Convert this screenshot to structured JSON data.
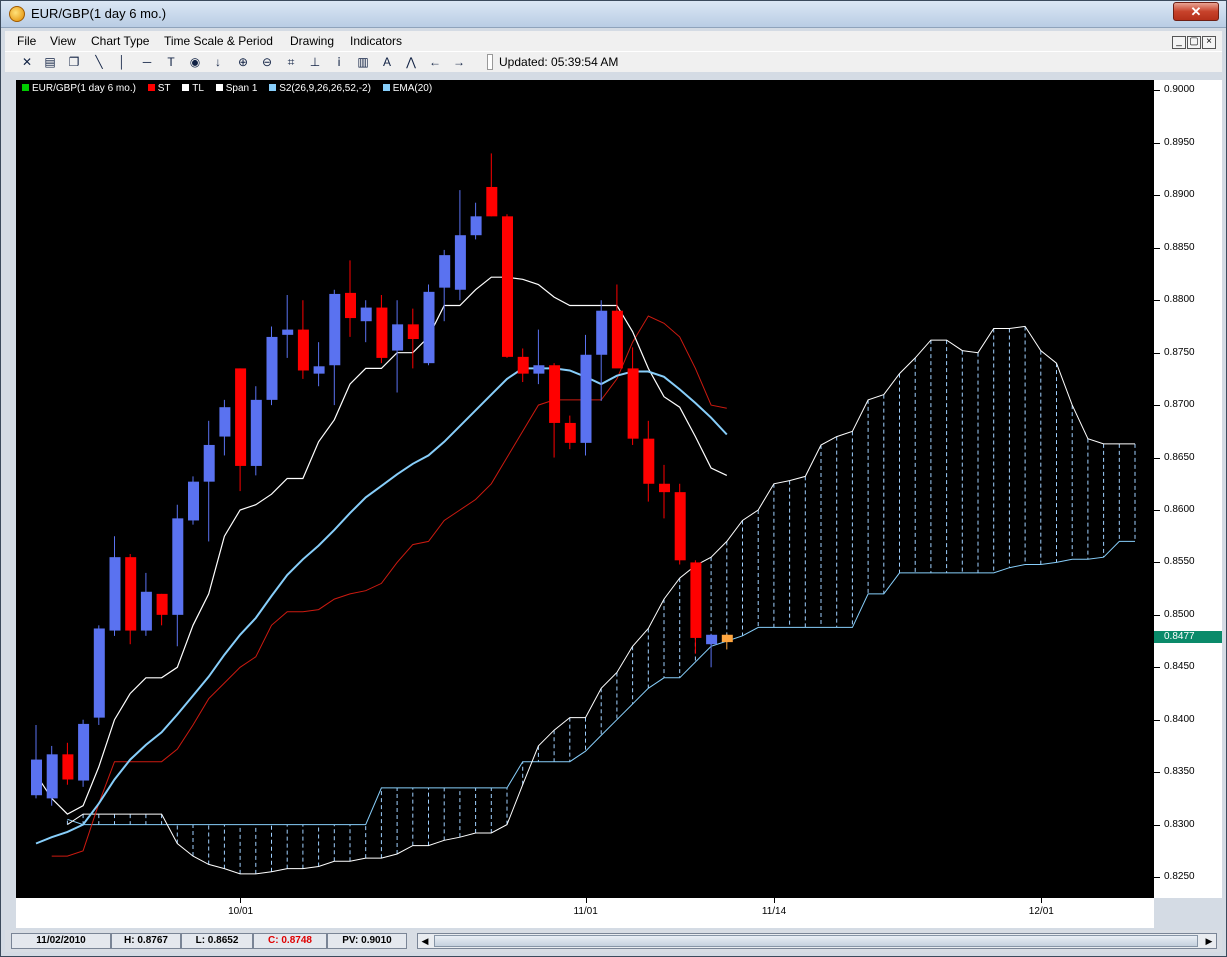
{
  "window": {
    "title": "EUR/GBP(1 day  6 mo.)",
    "close_label": "✕"
  },
  "menu": [
    "File",
    "View",
    "Chart Type",
    "Time Scale & Period",
    "Drawing",
    "Indicators"
  ],
  "toolbar": {
    "icons": [
      "crosshair-icon",
      "print-icon",
      "copy-icon",
      "trendline-icon",
      "vertical-line-icon",
      "horizontal-line-icon",
      "text-icon",
      "target-icon",
      "down-arrow-icon",
      "zoom-in-icon",
      "zoom-out-icon",
      "fit-icon",
      "anchor-icon",
      "info-icon",
      "bar-icon",
      "text-a-icon",
      "zigzag-icon",
      "left-arrow-icon",
      "right-arrow-icon"
    ],
    "updated": "Updated: 05:39:54 AM"
  },
  "status": {
    "date": "11/02/2010",
    "high": "H: 0.8767",
    "low": "L: 0.8652",
    "close": "C: 0.8748",
    "pv": "PV: 0.9010"
  },
  "colors": {
    "up": "#5a72f0",
    "down": "#ff0000",
    "last": "#ffa640",
    "ema": "#87cefa",
    "kijun": "#ffffff",
    "tenkan": "#cc1a10",
    "cloud": "#9fd0ff"
  },
  "chart_data": {
    "type": "candlestick",
    "title": "",
    "legend": [
      {
        "name": "EUR/GBP(1 day  6 mo.)",
        "color": "#00cc00"
      },
      {
        "name": "ST",
        "color": "#ff0000"
      },
      {
        "name": "TL",
        "color": "#ffffff"
      },
      {
        "name": "Span 1",
        "color": "#ffffff"
      },
      {
        "name": "S2(26,9,26,26,52,-2)",
        "color": "#87cefa"
      },
      {
        "name": "EMA(20)",
        "color": "#87cefa"
      }
    ],
    "legend_position": "top-left",
    "y_ticks": [
      "0.9000",
      "0.8950",
      "0.8900",
      "0.8850",
      "0.8800",
      "0.8750",
      "0.8700",
      "0.8650",
      "0.8600",
      "0.8550",
      "0.8500",
      "0.8450",
      "0.8400",
      "0.8350",
      "0.8300",
      "0.8250"
    ],
    "ylim": [
      0.823,
      0.901
    ],
    "x_ticks": [
      {
        "label": "10/01",
        "i": 13
      },
      {
        "label": "11/01",
        "i": 35
      },
      {
        "label": "11/14",
        "i": 47
      },
      {
        "label": "12/01",
        "i": 64
      }
    ],
    "current_value": "0.8477",
    "candles": [
      {
        "o": 0.8328,
        "h": 0.8395,
        "l": 0.8325,
        "c": 0.8362
      },
      {
        "o": 0.8325,
        "h": 0.8375,
        "l": 0.8318,
        "c": 0.8367
      },
      {
        "o": 0.8367,
        "h": 0.8378,
        "l": 0.8338,
        "c": 0.8343
      },
      {
        "o": 0.8342,
        "h": 0.84,
        "l": 0.8336,
        "c": 0.8396
      },
      {
        "o": 0.8402,
        "h": 0.849,
        "l": 0.8395,
        "c": 0.8487
      },
      {
        "o": 0.8485,
        "h": 0.8575,
        "l": 0.848,
        "c": 0.8555
      },
      {
        "o": 0.8555,
        "h": 0.8558,
        "l": 0.8472,
        "c": 0.8485
      },
      {
        "o": 0.8485,
        "h": 0.854,
        "l": 0.848,
        "c": 0.8522
      },
      {
        "o": 0.852,
        "h": 0.852,
        "l": 0.849,
        "c": 0.85
      },
      {
        "o": 0.85,
        "h": 0.8605,
        "l": 0.847,
        "c": 0.8592
      },
      {
        "o": 0.859,
        "h": 0.8632,
        "l": 0.8586,
        "c": 0.8627
      },
      {
        "o": 0.8627,
        "h": 0.8685,
        "l": 0.857,
        "c": 0.8662
      },
      {
        "o": 0.867,
        "h": 0.8705,
        "l": 0.8652,
        "c": 0.8698
      },
      {
        "o": 0.8735,
        "h": 0.8735,
        "l": 0.8618,
        "c": 0.8642
      },
      {
        "o": 0.8642,
        "h": 0.8718,
        "l": 0.8633,
        "c": 0.8705
      },
      {
        "o": 0.8705,
        "h": 0.8775,
        "l": 0.87,
        "c": 0.8765
      },
      {
        "o": 0.8767,
        "h": 0.8805,
        "l": 0.8745,
        "c": 0.8772
      },
      {
        "o": 0.8772,
        "h": 0.88,
        "l": 0.8725,
        "c": 0.8733
      },
      {
        "o": 0.873,
        "h": 0.876,
        "l": 0.8718,
        "c": 0.8737
      },
      {
        "o": 0.8738,
        "h": 0.881,
        "l": 0.87,
        "c": 0.8806
      },
      {
        "o": 0.8807,
        "h": 0.8838,
        "l": 0.8765,
        "c": 0.8783
      },
      {
        "o": 0.878,
        "h": 0.88,
        "l": 0.876,
        "c": 0.8793
      },
      {
        "o": 0.8793,
        "h": 0.8805,
        "l": 0.874,
        "c": 0.8745
      },
      {
        "o": 0.8752,
        "h": 0.88,
        "l": 0.8712,
        "c": 0.8777
      },
      {
        "o": 0.8777,
        "h": 0.8792,
        "l": 0.8735,
        "c": 0.8763
      },
      {
        "o": 0.874,
        "h": 0.8815,
        "l": 0.8738,
        "c": 0.8808
      },
      {
        "o": 0.8812,
        "h": 0.8848,
        "l": 0.878,
        "c": 0.8843
      },
      {
        "o": 0.881,
        "h": 0.8905,
        "l": 0.88,
        "c": 0.8862
      },
      {
        "o": 0.8862,
        "h": 0.8893,
        "l": 0.8858,
        "c": 0.888
      },
      {
        "o": 0.8908,
        "h": 0.894,
        "l": 0.888,
        "c": 0.888
      },
      {
        "o": 0.888,
        "h": 0.8882,
        "l": 0.8745,
        "c": 0.8746
      },
      {
        "o": 0.8746,
        "h": 0.8754,
        "l": 0.8722,
        "c": 0.873
      },
      {
        "o": 0.873,
        "h": 0.8772,
        "l": 0.872,
        "c": 0.8738
      },
      {
        "o": 0.8738,
        "h": 0.874,
        "l": 0.865,
        "c": 0.8683
      },
      {
        "o": 0.8683,
        "h": 0.869,
        "l": 0.8658,
        "c": 0.8664
      },
      {
        "o": 0.8664,
        "h": 0.8767,
        "l": 0.8652,
        "c": 0.8748
      },
      {
        "o": 0.8748,
        "h": 0.88,
        "l": 0.8704,
        "c": 0.879
      },
      {
        "o": 0.879,
        "h": 0.8815,
        "l": 0.874,
        "c": 0.8735
      },
      {
        "o": 0.8735,
        "h": 0.8755,
        "l": 0.8662,
        "c": 0.8668
      },
      {
        "o": 0.8668,
        "h": 0.8685,
        "l": 0.8608,
        "c": 0.8625
      },
      {
        "o": 0.8625,
        "h": 0.8643,
        "l": 0.8592,
        "c": 0.8617
      },
      {
        "o": 0.8617,
        "h": 0.8625,
        "l": 0.8548,
        "c": 0.8552
      },
      {
        "o": 0.855,
        "h": 0.8552,
        "l": 0.8463,
        "c": 0.8478
      },
      {
        "o": 0.8472,
        "h": 0.8482,
        "l": 0.845,
        "c": 0.8481
      },
      {
        "o": 0.8474,
        "h": 0.8482,
        "l": 0.8467,
        "c": 0.8481
      }
    ],
    "series": [
      {
        "name": "EMA(20)",
        "color": "#87cefa",
        "x": [
          0,
          1,
          2,
          3,
          4,
          5,
          6,
          7,
          8,
          9,
          10,
          11,
          12,
          13,
          14,
          15,
          16,
          17,
          18,
          19,
          20,
          21,
          22,
          23,
          24,
          25,
          26,
          27,
          28,
          29,
          30,
          31,
          32,
          33,
          34,
          35,
          36,
          37,
          38,
          39,
          40,
          41,
          42,
          43,
          44
        ],
        "values": [
          0.8282,
          0.8288,
          0.8293,
          0.83,
          0.832,
          0.8343,
          0.8362,
          0.8376,
          0.8388,
          0.8405,
          0.8423,
          0.8441,
          0.8462,
          0.8481,
          0.8497,
          0.8518,
          0.8538,
          0.8553,
          0.8566,
          0.8581,
          0.8597,
          0.8612,
          0.8623,
          0.8634,
          0.8644,
          0.8652,
          0.8665,
          0.868,
          0.8695,
          0.871,
          0.8725,
          0.8735,
          0.8735,
          0.8735,
          0.8733,
          0.8727,
          0.872,
          0.8728,
          0.8732,
          0.8732,
          0.8727,
          0.8715,
          0.8702,
          0.8688,
          0.8672
        ]
      },
      {
        "name": "TL",
        "color": "#ffffff",
        "x": [
          0,
          1,
          2,
          3,
          4,
          5,
          6,
          7,
          8,
          9,
          10,
          11,
          12,
          13,
          14,
          15,
          16,
          17,
          18,
          19,
          20,
          21,
          22,
          23,
          24,
          25,
          26,
          27,
          28,
          29,
          30,
          31,
          32,
          33,
          34,
          35,
          36,
          37,
          38,
          39,
          40,
          41,
          42,
          43,
          44
        ],
        "values": [
          0.8348,
          0.8325,
          0.831,
          0.8318,
          0.8355,
          0.84,
          0.8425,
          0.844,
          0.844,
          0.845,
          0.849,
          0.852,
          0.8575,
          0.86,
          0.8605,
          0.8615,
          0.863,
          0.863,
          0.8665,
          0.8686,
          0.872,
          0.8735,
          0.8735,
          0.875,
          0.875,
          0.8765,
          0.8795,
          0.8795,
          0.881,
          0.8822,
          0.8822,
          0.882,
          0.8815,
          0.8803,
          0.8795,
          0.8795,
          0.8795,
          0.8795,
          0.877,
          0.8735,
          0.8708,
          0.8698,
          0.867,
          0.864,
          0.8633
        ]
      },
      {
        "name": "ST",
        "color": "#cc1a10",
        "x": [
          1,
          2,
          3,
          4,
          5,
          6,
          7,
          8,
          9,
          10,
          11,
          12,
          13,
          14,
          15,
          16,
          17,
          18,
          19,
          20,
          21,
          22,
          23,
          24,
          25,
          26,
          27,
          28,
          29,
          30,
          31,
          32,
          33,
          34,
          35,
          36,
          37,
          38,
          39,
          40,
          41,
          42,
          43,
          44
        ],
        "values": [
          0.827,
          0.827,
          0.8275,
          0.832,
          0.836,
          0.836,
          0.836,
          0.836,
          0.8372,
          0.8395,
          0.842,
          0.8435,
          0.845,
          0.846,
          0.849,
          0.8503,
          0.8503,
          0.8505,
          0.8515,
          0.852,
          0.8523,
          0.853,
          0.855,
          0.8567,
          0.857,
          0.859,
          0.86,
          0.861,
          0.8625,
          0.865,
          0.8675,
          0.87,
          0.8705,
          0.8705,
          0.8705,
          0.8705,
          0.8725,
          0.876,
          0.8785,
          0.8778,
          0.8765,
          0.8735,
          0.87,
          0.8697
        ]
      },
      {
        "name": "Span 1",
        "color": "#ffffff",
        "x": [
          2,
          3,
          4,
          5,
          6,
          7,
          8,
          9,
          10,
          11,
          12,
          13,
          14,
          15,
          16,
          17,
          18,
          19,
          20,
          21,
          22,
          23,
          24,
          25,
          26,
          27,
          28,
          29,
          30,
          31,
          32,
          33,
          34,
          35,
          36,
          37,
          38,
          39,
          40,
          41,
          42,
          43,
          44,
          45,
          46,
          47,
          48,
          49,
          50,
          51,
          52,
          53,
          54,
          55,
          56,
          57,
          58,
          59,
          60,
          61,
          62,
          63,
          64,
          65,
          66,
          67,
          68,
          69,
          70
        ],
        "values": [
          0.83,
          0.831,
          0.831,
          0.831,
          0.831,
          0.831,
          0.831,
          0.8282,
          0.827,
          0.8262,
          0.8258,
          0.8253,
          0.8253,
          0.8255,
          0.8258,
          0.8258,
          0.826,
          0.8265,
          0.8265,
          0.8268,
          0.8268,
          0.8272,
          0.828,
          0.828,
          0.8285,
          0.8288,
          0.8292,
          0.8292,
          0.83,
          0.8338,
          0.8375,
          0.839,
          0.8402,
          0.8402,
          0.843,
          0.8445,
          0.847,
          0.8487,
          0.8515,
          0.8535,
          0.8547,
          0.8555,
          0.857,
          0.859,
          0.86,
          0.8625,
          0.8628,
          0.8632,
          0.8662,
          0.867,
          0.8675,
          0.8705,
          0.871,
          0.873,
          0.8745,
          0.8762,
          0.8762,
          0.8752,
          0.875,
          0.8773,
          0.8773,
          0.8775,
          0.8752,
          0.874,
          0.87,
          0.8668,
          0.8663,
          0.8663,
          0.8663
        ]
      },
      {
        "name": "S2(26,9,26,26,52,-2)",
        "color": "#87cefa",
        "x": [
          2,
          3,
          4,
          5,
          6,
          7,
          8,
          9,
          10,
          11,
          12,
          13,
          14,
          15,
          16,
          17,
          18,
          19,
          20,
          21,
          22,
          23,
          24,
          25,
          26,
          27,
          28,
          29,
          30,
          31,
          32,
          33,
          34,
          35,
          36,
          37,
          38,
          39,
          40,
          41,
          42,
          43,
          44,
          45,
          46,
          47,
          48,
          49,
          50,
          51,
          52,
          53,
          54,
          55,
          56,
          57,
          58,
          59,
          60,
          61,
          62,
          63,
          64,
          65,
          66,
          67,
          68,
          69,
          70
        ],
        "values": [
          0.8305,
          0.83,
          0.83,
          0.83,
          0.83,
          0.83,
          0.83,
          0.83,
          0.83,
          0.83,
          0.83,
          0.83,
          0.83,
          0.83,
          0.83,
          0.83,
          0.83,
          0.83,
          0.83,
          0.83,
          0.8335,
          0.8335,
          0.8335,
          0.8335,
          0.8335,
          0.8335,
          0.8335,
          0.8335,
          0.8335,
          0.836,
          0.836,
          0.836,
          0.836,
          0.837,
          0.8385,
          0.84,
          0.8415,
          0.843,
          0.844,
          0.844,
          0.8455,
          0.847,
          0.8475,
          0.848,
          0.8488,
          0.8488,
          0.8488,
          0.8488,
          0.8488,
          0.8488,
          0.8488,
          0.852,
          0.852,
          0.854,
          0.854,
          0.854,
          0.854,
          0.854,
          0.854,
          0.854,
          0.8545,
          0.8548,
          0.8548,
          0.855,
          0.8553,
          0.8553,
          0.8555,
          0.857,
          0.857
        ]
      }
    ]
  }
}
